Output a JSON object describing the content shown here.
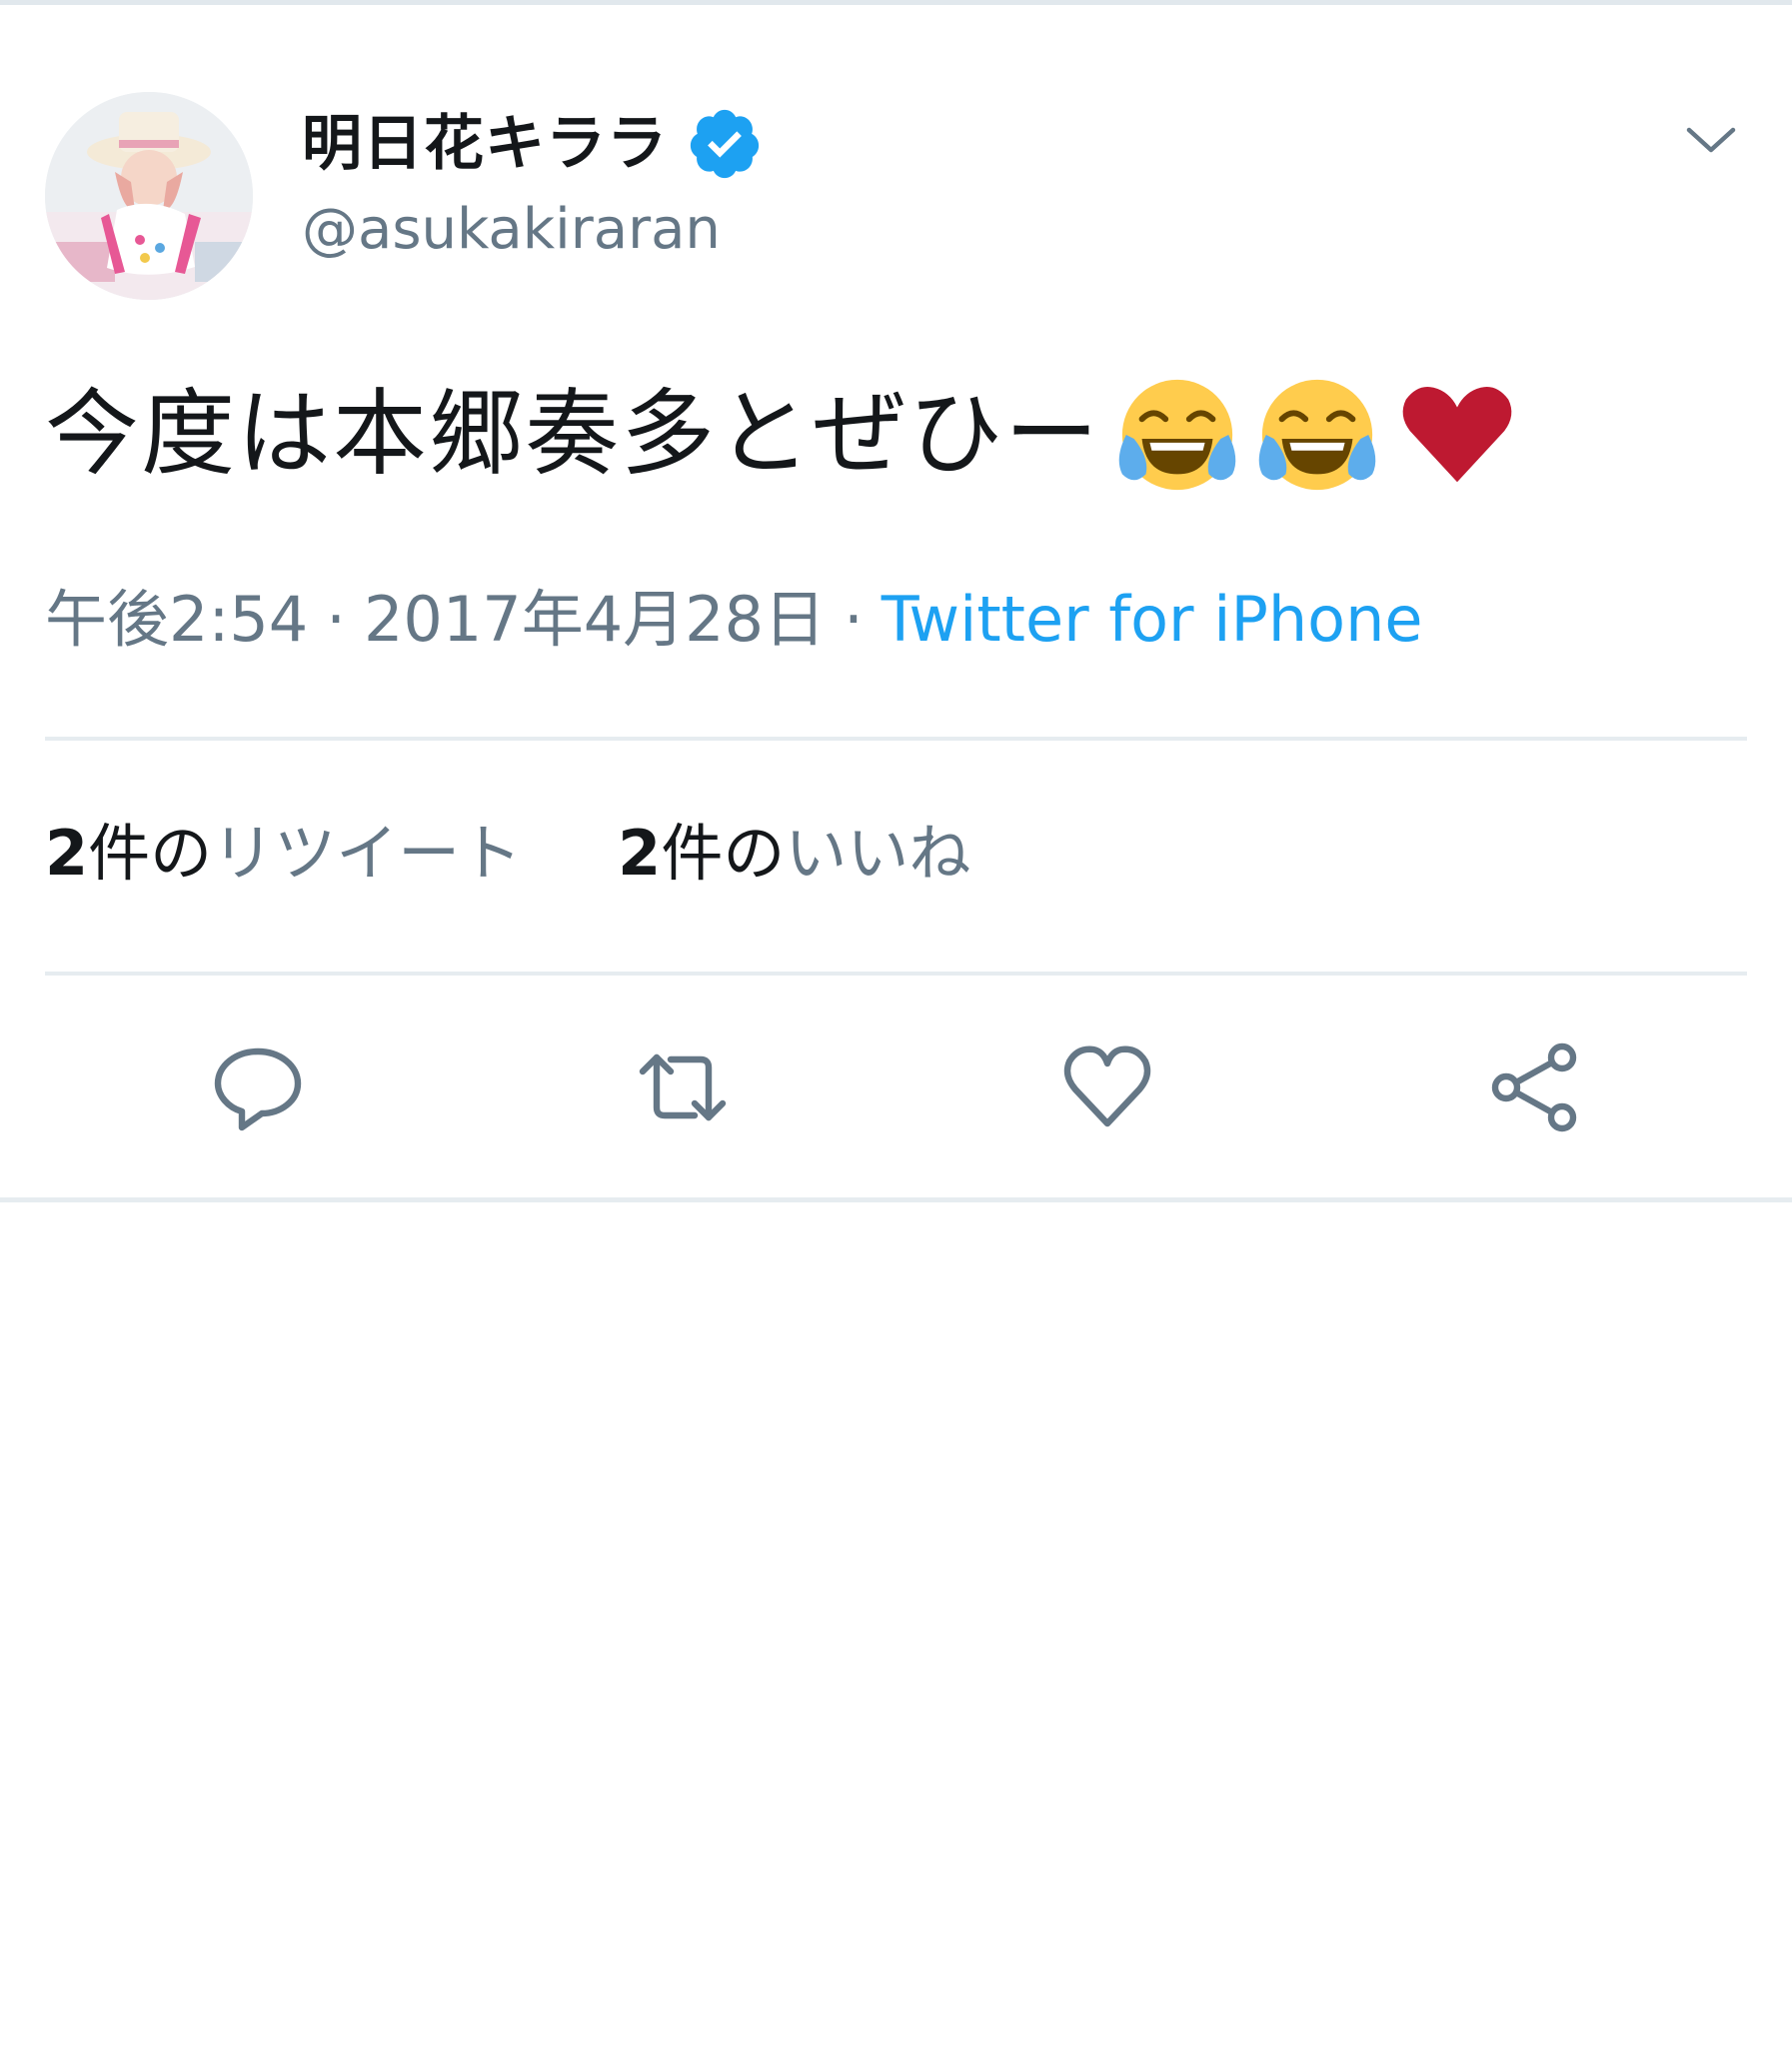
{
  "author": {
    "display_name": "明日花キララ",
    "handle": "@asukakiraran",
    "verified": true,
    "avatar_icon": "profile-photo"
  },
  "tweet": {
    "text": "今度は本郷奏多とぜひー",
    "trailing_emojis": [
      "face-with-tears-of-joy",
      "face-with-tears-of-joy",
      "red-heart"
    ],
    "time": "午後2:54",
    "separator": "·",
    "date": "2017年4月28日",
    "source": "Twitter for iPhone"
  },
  "stats": {
    "retweets": {
      "count": "2",
      "unit": "件の",
      "label": "リツイート"
    },
    "likes": {
      "count": "2",
      "unit": "件の",
      "label": "いいね"
    }
  },
  "actions": [
    "reply-icon",
    "retweet-icon",
    "like-icon",
    "share-icon"
  ],
  "colors": {
    "text_primary": "#14171a",
    "text_secondary": "#657786",
    "link": "#1da1f2",
    "verified": "#1da1f2",
    "divider": "#e6ecf0",
    "heart": "#be1931"
  }
}
